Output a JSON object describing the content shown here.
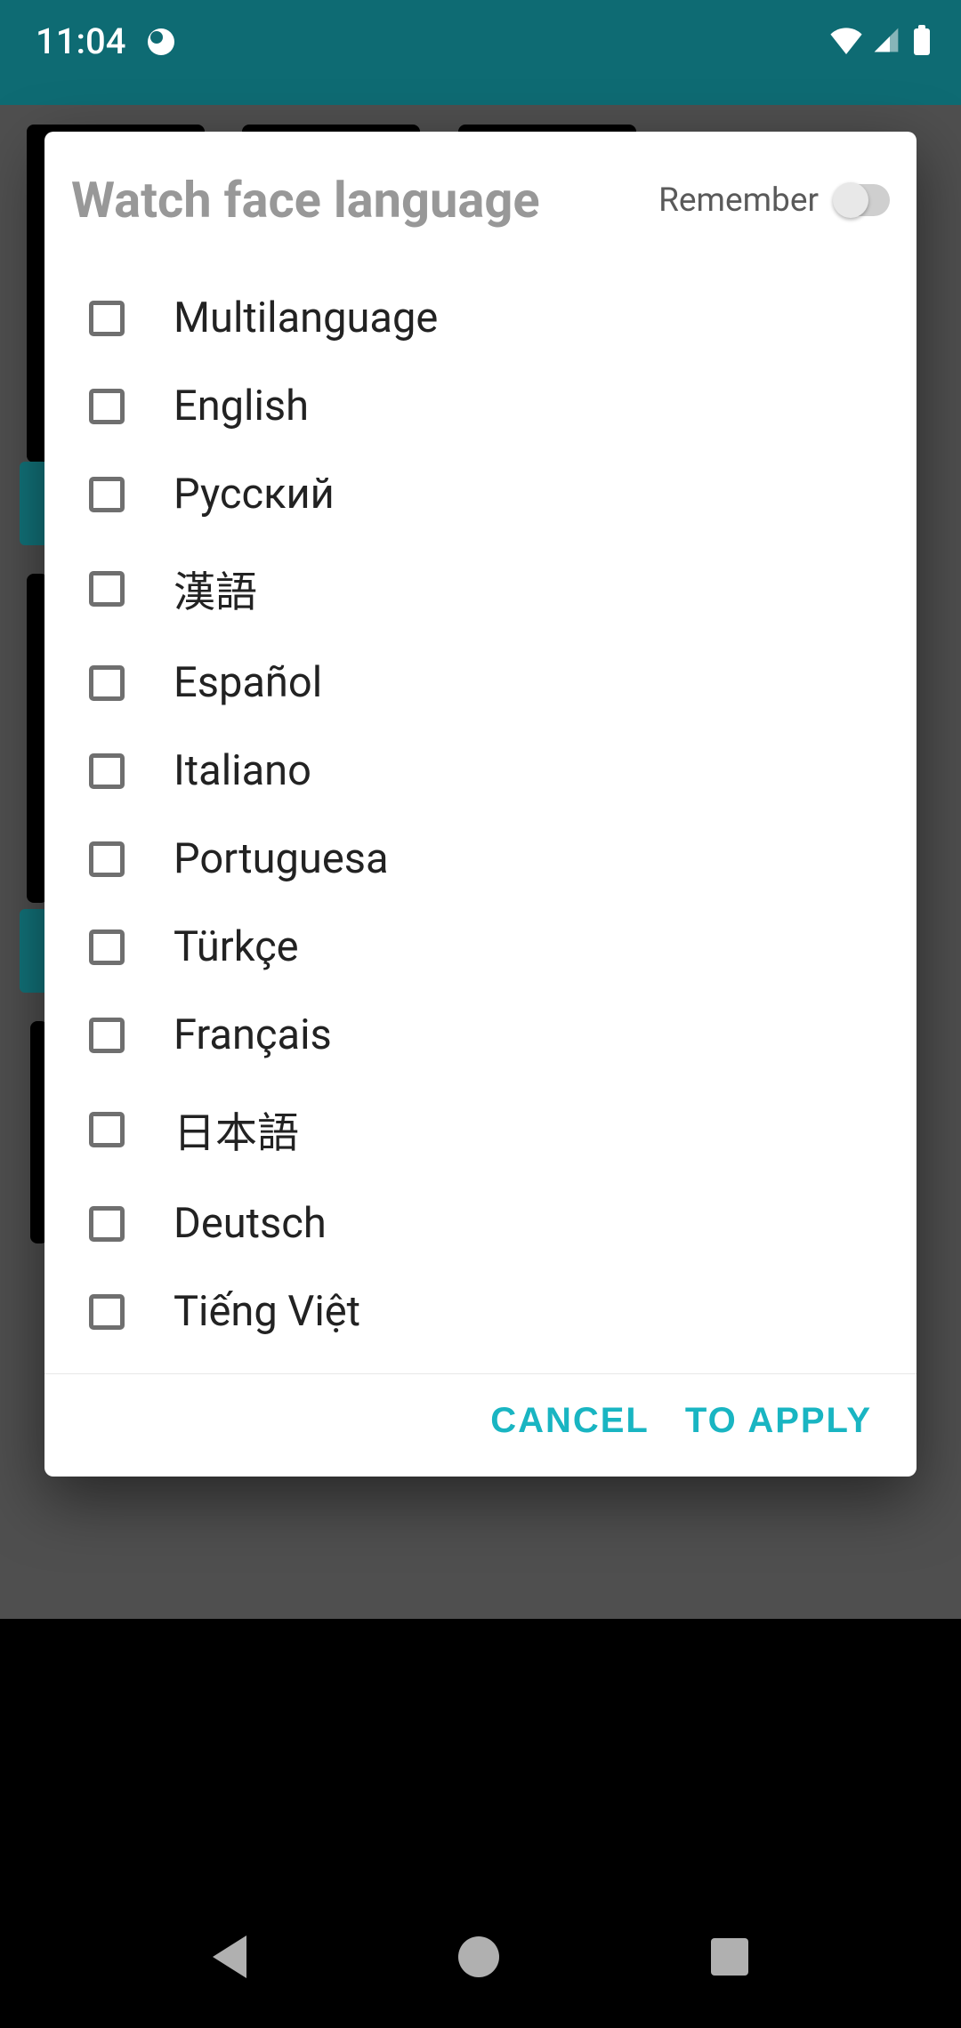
{
  "status": {
    "time": "11:04"
  },
  "dialog": {
    "title": "Watch face language",
    "remember_label": "Remember",
    "remember_on": false,
    "languages": [
      {
        "label": "Multilanguage",
        "checked": false
      },
      {
        "label": "English",
        "checked": false
      },
      {
        "label": "Русский",
        "checked": false
      },
      {
        "label": "漢語",
        "checked": false
      },
      {
        "label": "Español",
        "checked": false
      },
      {
        "label": "Italiano",
        "checked": false
      },
      {
        "label": "Portuguesa",
        "checked": false
      },
      {
        "label": "Türkçe",
        "checked": false
      },
      {
        "label": "Français",
        "checked": false
      },
      {
        "label": "日本語",
        "checked": false
      },
      {
        "label": "Deutsch",
        "checked": false
      },
      {
        "label": "Tiếng Việt",
        "checked": false
      }
    ],
    "cancel_label": "CANCEL",
    "apply_label": "TO APPLY"
  },
  "colors": {
    "status_bg": "#0e6b73",
    "accent": "#19b5c2",
    "title_muted": "#989898"
  }
}
